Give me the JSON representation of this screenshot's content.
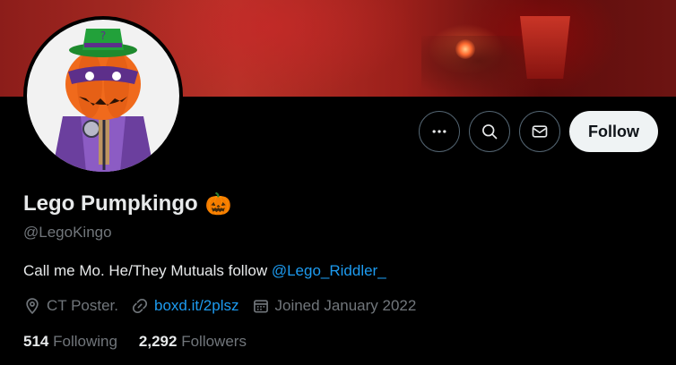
{
  "profile": {
    "display_name": "Lego Pumpkingo",
    "name_emoji": "🎃",
    "handle": "@LegoKingo",
    "bio_text": "Call me Mo. He/They Mutuals follow ",
    "bio_mention": "@Lego_Riddler_",
    "location": "CT Poster.",
    "website": "boxd.it/2plsz",
    "joined": "Joined January 2022"
  },
  "actions": {
    "more_icon": "more-icon",
    "search_icon": "search-icon",
    "message_icon": "mail-icon",
    "follow_label": "Follow"
  },
  "stats": {
    "following_count": "514",
    "following_label": "Following",
    "followers_count": "2,292",
    "followers_label": "Followers"
  },
  "colors": {
    "background": "#000000",
    "text_primary": "#e7e9ea",
    "text_secondary": "#71767b",
    "link": "#1d9bf0",
    "follow_button_bg": "#eff3f4"
  }
}
